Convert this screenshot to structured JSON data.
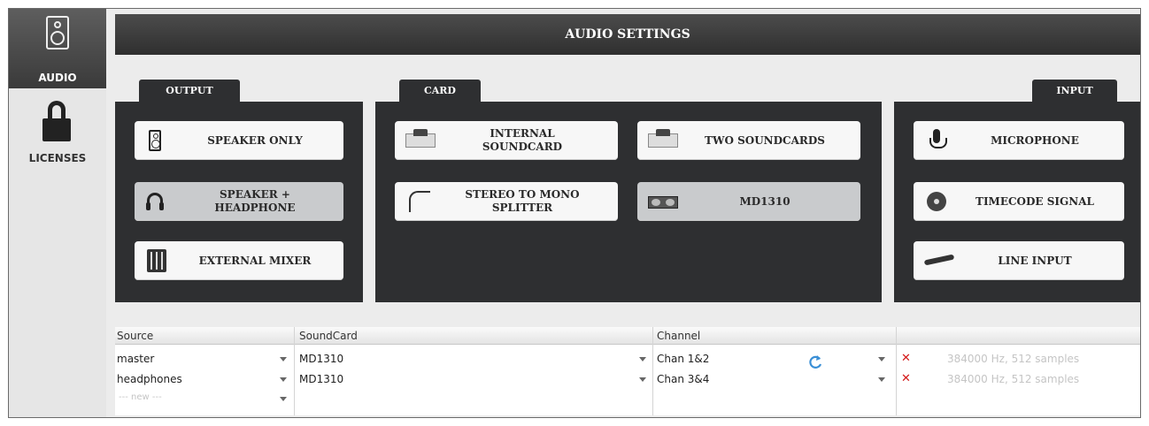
{
  "sidebar": {
    "items": [
      {
        "label": "AUDIO",
        "icon": "speaker-icon",
        "active": true
      },
      {
        "label": "LICENSES",
        "icon": "lock-icon",
        "active": false
      }
    ]
  },
  "header": {
    "title": "AUDIO SETTINGS"
  },
  "output": {
    "tab": "OUTPUT",
    "buttons": [
      {
        "label": "SPEAKER ONLY",
        "icon": "speaker-icon",
        "selected": false
      },
      {
        "label": "SPEAKER +\nHEADPHONE",
        "icon": "headphone-icon",
        "selected": true
      },
      {
        "label": "EXTERNAL MIXER",
        "icon": "mixer-icon",
        "selected": false
      }
    ]
  },
  "card": {
    "tab": "CARD",
    "buttons": [
      {
        "label": "INTERNAL\nSOUNDCARD",
        "icon": "soundcard-icon",
        "selected": false
      },
      {
        "label": "TWO SOUNDCARDS",
        "icon": "two-soundcards-icon",
        "selected": false
      },
      {
        "label": "STEREO TO MONO\nSPLITTER",
        "icon": "splitter-cable-icon",
        "selected": false
      },
      {
        "label": "MD1310",
        "icon": "md1310-controller-icon",
        "selected": true
      }
    ]
  },
  "input": {
    "tab": "INPUT",
    "buttons": [
      {
        "label": "MICROPHONE",
        "icon": "microphone-icon",
        "selected": false
      },
      {
        "label": "TIMECODE SIGNAL",
        "icon": "vinyl-disc-icon",
        "selected": false
      },
      {
        "label": "LINE INPUT",
        "icon": "line-cable-icon",
        "selected": false
      }
    ]
  },
  "routing": {
    "headers": [
      "Source",
      "SoundCard",
      "Channel",
      ""
    ],
    "rows": [
      {
        "source": "master",
        "soundcard": "MD1310",
        "channel": "Chan 1&2",
        "status": "384000 Hz, 512 samples"
      },
      {
        "source": "headphones",
        "soundcard": "MD1310",
        "channel": "Chan 3&4",
        "status": "384000 Hz, 512 samples"
      }
    ],
    "new_row_placeholder": "--- new ---"
  },
  "colors": {
    "panel_bg": "#2e2f31",
    "header_bg": "#3a3a3a",
    "button_bg": "#f7f7f7",
    "selected_button_bg": "#c9cbcd",
    "remove_red": "#d41919",
    "refresh_blue": "#3a8fd6"
  }
}
